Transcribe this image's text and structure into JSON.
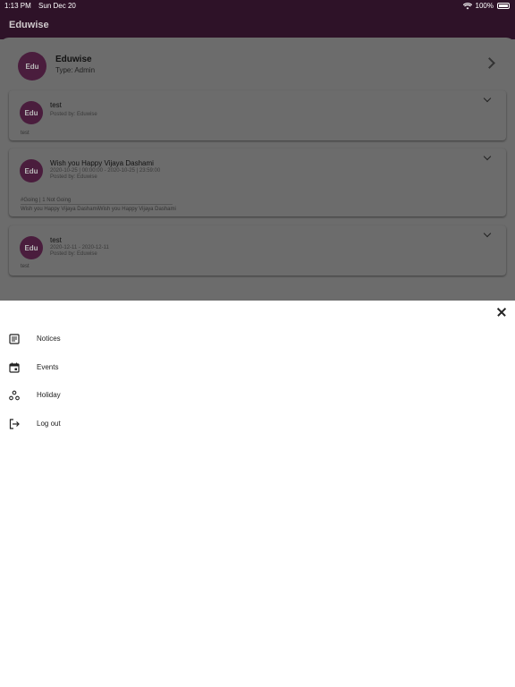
{
  "status": {
    "time": "1:13 PM",
    "date": "Sun Dec 20",
    "battery": "100%"
  },
  "app": {
    "title": "Eduwise"
  },
  "profile": {
    "logo_text": "Edu",
    "name": "Eduwise",
    "type": "Type: Admin"
  },
  "notices": [
    {
      "title": "test",
      "posted": "Posted by: Eduwise",
      "body": "test"
    },
    {
      "title": "Wish you Happy Vijaya Dashami",
      "date": "2020-10-25 | 00:00:00 - 2020-10-25 | 23:59:00",
      "posted": "Posted by: Eduwise",
      "tags": "#Going | 1 Not Going",
      "body": "Wish you Happy Vijaya DashamiWish you Happy Vijaya Dashami"
    },
    {
      "title": "test",
      "date": "2020-12-11 - 2020-12-11",
      "posted": "Posted by: Eduwise",
      "body": "test"
    }
  ],
  "drawer": {
    "items": [
      {
        "label": "Notices",
        "icon": "notices-icon"
      },
      {
        "label": "Events",
        "icon": "calendar-icon"
      },
      {
        "label": "Holiday",
        "icon": "holiday-icon"
      },
      {
        "label": "Log out",
        "icon": "logout-icon"
      }
    ]
  }
}
